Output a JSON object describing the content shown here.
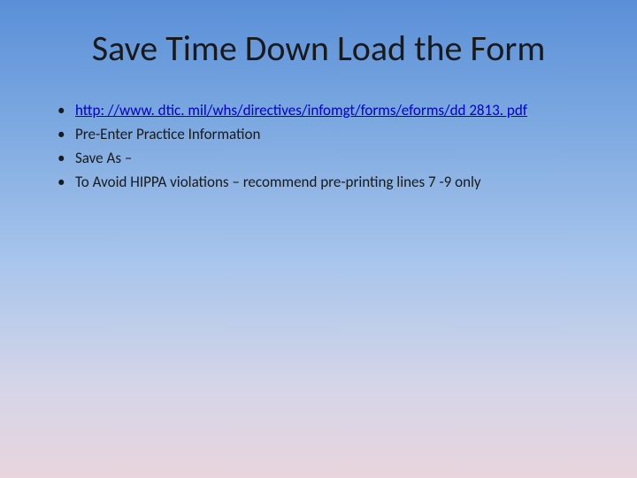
{
  "slide": {
    "title": "Save Time Down Load the Form",
    "bullets": [
      {
        "text": "http: //www. dtic. mil/whs/directives/infomgt/forms/eforms/dd 2813. pdf",
        "isLink": true
      },
      {
        "text": "Pre-Enter Practice Information",
        "isLink": false
      },
      {
        "text": "Save As –",
        "isLink": false
      },
      {
        "text": "To Avoid HIPPA violations – recommend pre-printing lines 7 -9 only",
        "isLink": false
      }
    ]
  }
}
